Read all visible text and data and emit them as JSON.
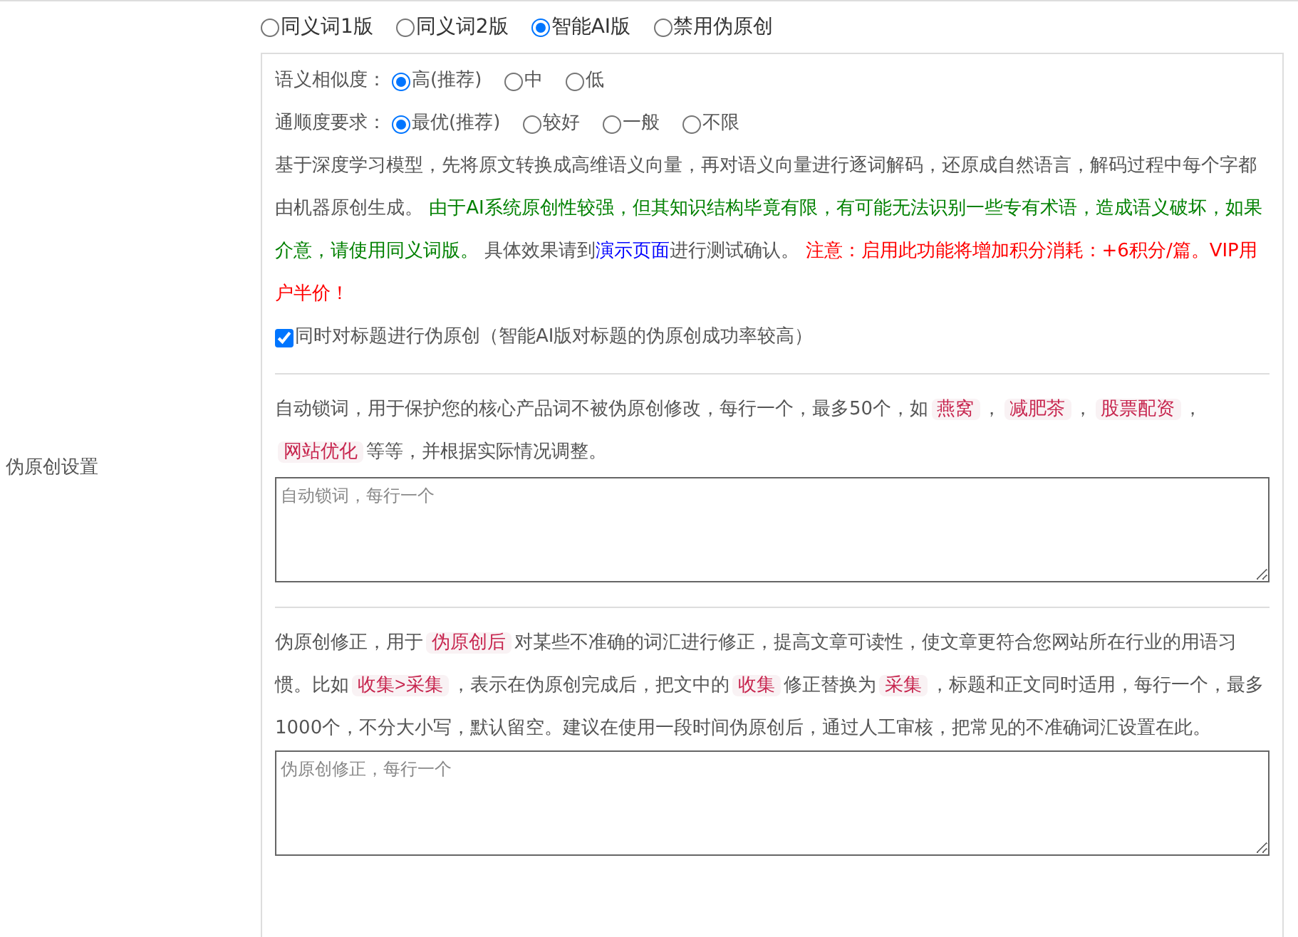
{
  "modes": [
    {
      "label": "同义词1版",
      "selected": false
    },
    {
      "label": "同义词2版",
      "selected": false
    },
    {
      "label": "智能AI版",
      "selected": true
    },
    {
      "label": "禁用伪原创",
      "selected": false
    }
  ],
  "similarity": {
    "label": "语义相似度：",
    "options": [
      {
        "label": "高(推荐)",
        "selected": true
      },
      {
        "label": "中",
        "selected": false
      },
      {
        "label": "低",
        "selected": false
      }
    ]
  },
  "fluency": {
    "label": "通顺度要求：",
    "options": [
      {
        "label": "最优(推荐)",
        "selected": true
      },
      {
        "label": "较好",
        "selected": false
      },
      {
        "label": "一般",
        "selected": false
      },
      {
        "label": "不限",
        "selected": false
      }
    ]
  },
  "description": [
    {
      "kind": "text",
      "text": "基于深度学习模型，先将原文转换成高维语义向量，再对语义向量进行逐词解码，还原成自然语言，解码过程中每个字都由机器原创生成。 "
    },
    {
      "kind": "green",
      "text": "由于AI系统原创性较强，但其知识结构毕竟有限，有可能无法识别一些专有术语，造成语义破坏，如果介意，请使用同义词版。"
    },
    {
      "kind": "text",
      "text": " 具体效果请到"
    },
    {
      "kind": "link",
      "text": "演示页面"
    },
    {
      "kind": "text",
      "text": "进行测试确认。 "
    },
    {
      "kind": "red",
      "text": "注意：启用此功能将增加积分消耗：+6积分/篇。VIP用户半价！"
    }
  ],
  "title_option": {
    "label": "同时对标题进行伪原创（智能AI版对标题的伪原创成功率较高）",
    "checked": true
  },
  "side_label": "伪原创设置",
  "lock_words": {
    "segments": [
      {
        "kind": "text",
        "text": "自动锁词，用于保护您的核心产品词不被伪原创修改，每行一个，最多50个，如"
      },
      {
        "kind": "tag",
        "text": "燕窝"
      },
      {
        "kind": "text",
        "text": "，"
      },
      {
        "kind": "tag",
        "text": "减肥茶"
      },
      {
        "kind": "text",
        "text": "，"
      },
      {
        "kind": "tag",
        "text": "股票配资"
      },
      {
        "kind": "text",
        "text": "，"
      },
      {
        "kind": "tag",
        "text": "网站优化"
      },
      {
        "kind": "text",
        "text": "等等，并根据实际情况调整。"
      }
    ],
    "placeholder": "自动锁词，每行一个"
  },
  "correction": {
    "segments": [
      {
        "kind": "text",
        "text": "伪原创修正，用于"
      },
      {
        "kind": "tag",
        "text": "伪原创后"
      },
      {
        "kind": "text",
        "text": "对某些不准确的词汇进行修正，提高文章可读性，使文章更符合您网站所在行业的用语习惯。比如"
      },
      {
        "kind": "tag",
        "text": "收集>采集"
      },
      {
        "kind": "text",
        "text": "，表示在伪原创完成后，把文中的"
      },
      {
        "kind": "tag",
        "text": "收集"
      },
      {
        "kind": "text",
        "text": "修正替换为"
      },
      {
        "kind": "tag",
        "text": "采集"
      },
      {
        "kind": "text",
        "text": "，标题和正文同时适用，每行一个，最多1000个，不分大小写，默认留空。建议在使用一段时间伪原创后，通过人工审核，把常见的不准确词汇设置在此。"
      }
    ],
    "placeholder": "伪原创修正，每行一个"
  }
}
